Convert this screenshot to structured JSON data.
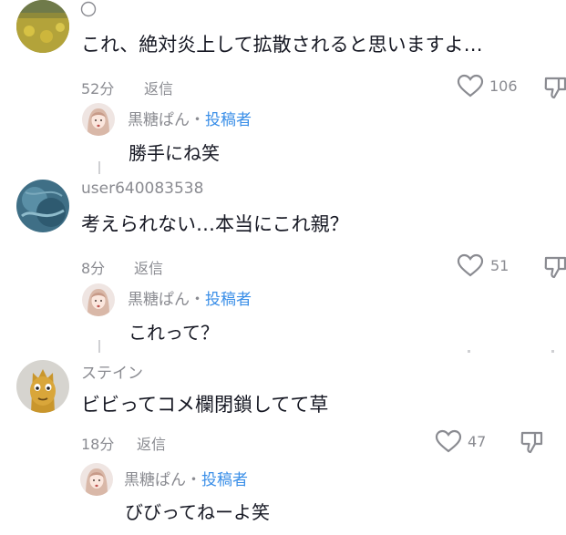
{
  "comments": [
    {
      "username": "",
      "text": "これ、絶対炎上して拡散されると思いますよ…",
      "time": "52分",
      "reply_label": "返信",
      "likes": "106",
      "replies": [
        {
          "name": "黒糖ぱん",
          "sep": "・",
          "author_tag": "投稿者",
          "text": "勝手にね笑"
        }
      ]
    },
    {
      "username": "user640083538",
      "text": "考えられない…本当にこれ親？",
      "time": "8分",
      "reply_label": "返信",
      "likes": "51",
      "replies": [
        {
          "name": "黒糖ぱん",
          "sep": "・",
          "author_tag": "投稿者",
          "text": "これって？"
        }
      ]
    },
    {
      "username": "ステイン",
      "text": "ビビってコメ欄閉鎖してて草",
      "time": "18分",
      "reply_label": "返信",
      "likes": "47",
      "replies": [
        {
          "name": "黒糖ぱん",
          "sep": "・",
          "author_tag": "投稿者",
          "text": "びびってねーよ笑"
        }
      ]
    }
  ],
  "icons": {
    "like": "heart-outline-icon",
    "dislike": "thumbs-down-icon"
  },
  "colors": {
    "text": "#161823",
    "secondary": "#8a8b91",
    "author_tag": "#3b8fe8"
  }
}
